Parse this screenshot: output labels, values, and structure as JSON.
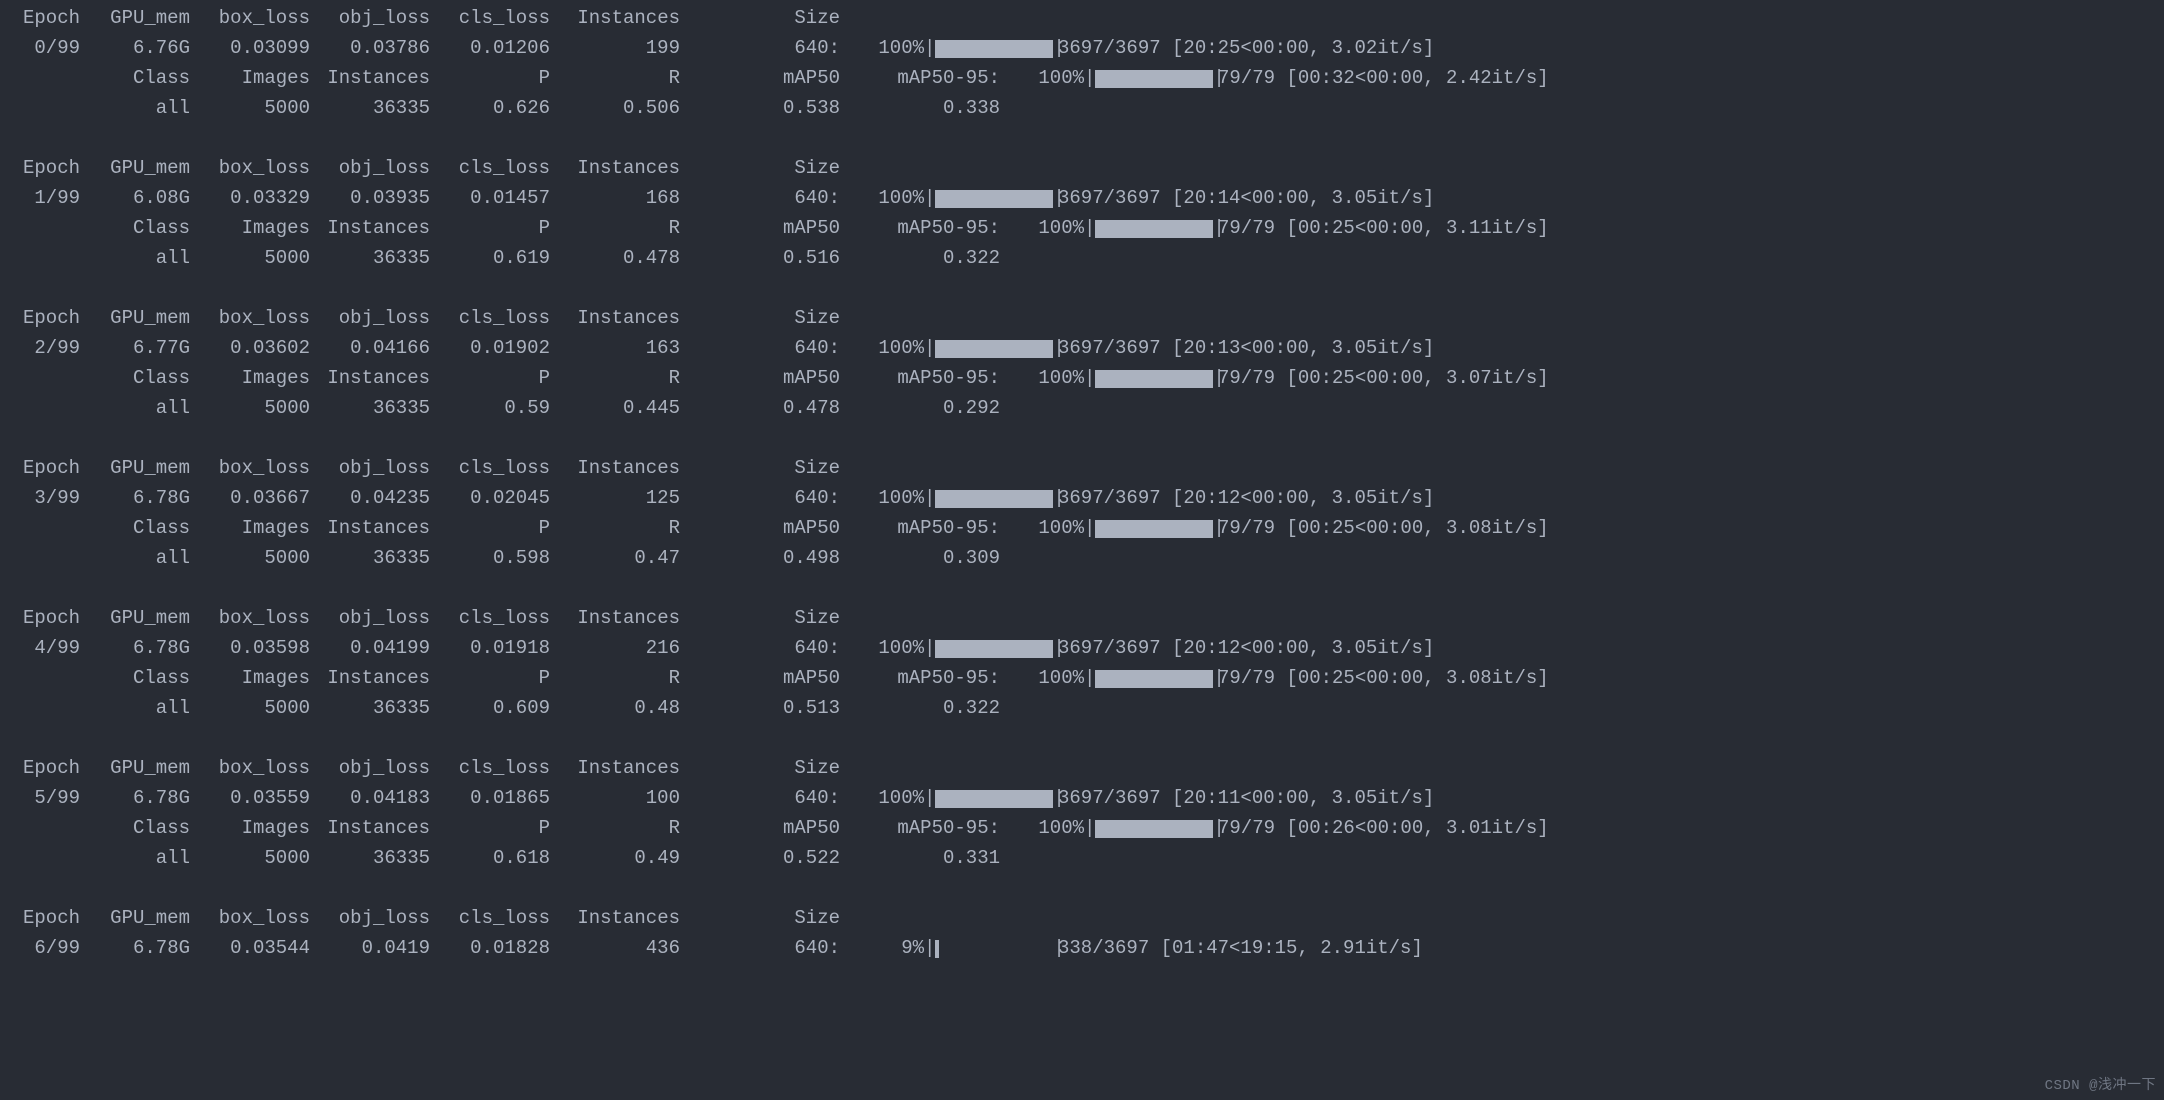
{
  "train_headers": {
    "epoch": "Epoch",
    "gpu_mem": "GPU_mem",
    "box_loss": "box_loss",
    "obj_loss": "obj_loss",
    "cls_loss": "cls_loss",
    "instances": "Instances",
    "size": "Size"
  },
  "val_headers": {
    "class": "Class",
    "images": "Images",
    "instances": "Instances",
    "p": "P",
    "r": "R",
    "map50": "mAP50",
    "map50_95_label": "mAP50-95:"
  },
  "epochs": [
    {
      "epoch": "0/99",
      "gpu_mem": "6.76G",
      "box_loss": "0.03099",
      "obj_loss": "0.03786",
      "cls_loss": "0.01206",
      "instances": "199",
      "size": "640:",
      "train_pct": "100%",
      "train_bar": "full",
      "train_stats": "3697/3697 [20:25<00:00,  3.02it/s]",
      "val_class": "all",
      "val_images": "5000",
      "val_instances": "36335",
      "val_p": "0.626",
      "val_r": "0.506",
      "val_map50": "0.538",
      "val_pct": "100%",
      "val_bar": "full",
      "val_stats": "79/79 [00:32<00:00,  2.42it/s]",
      "val_map50_95": "0.338"
    },
    {
      "epoch": "1/99",
      "gpu_mem": "6.08G",
      "box_loss": "0.03329",
      "obj_loss": "0.03935",
      "cls_loss": "0.01457",
      "instances": "168",
      "size": "640:",
      "train_pct": "100%",
      "train_bar": "full",
      "train_stats": "3697/3697 [20:14<00:00,  3.05it/s]",
      "val_class": "all",
      "val_images": "5000",
      "val_instances": "36335",
      "val_p": "0.619",
      "val_r": "0.478",
      "val_map50": "0.516",
      "val_pct": "100%",
      "val_bar": "full",
      "val_stats": "79/79 [00:25<00:00,  3.11it/s]",
      "val_map50_95": "0.322"
    },
    {
      "epoch": "2/99",
      "gpu_mem": "6.77G",
      "box_loss": "0.03602",
      "obj_loss": "0.04166",
      "cls_loss": "0.01902",
      "instances": "163",
      "size": "640:",
      "train_pct": "100%",
      "train_bar": "full",
      "train_stats": "3697/3697 [20:13<00:00,  3.05it/s]",
      "val_class": "all",
      "val_images": "5000",
      "val_instances": "36335",
      "val_p": "0.59",
      "val_r": "0.445",
      "val_map50": "0.478",
      "val_pct": "100%",
      "val_bar": "full",
      "val_stats": "79/79 [00:25<00:00,  3.07it/s]",
      "val_map50_95": "0.292"
    },
    {
      "epoch": "3/99",
      "gpu_mem": "6.78G",
      "box_loss": "0.03667",
      "obj_loss": "0.04235",
      "cls_loss": "0.02045",
      "instances": "125",
      "size": "640:",
      "train_pct": "100%",
      "train_bar": "full",
      "train_stats": "3697/3697 [20:12<00:00,  3.05it/s]",
      "val_class": "all",
      "val_images": "5000",
      "val_instances": "36335",
      "val_p": "0.598",
      "val_r": "0.47",
      "val_map50": "0.498",
      "val_pct": "100%",
      "val_bar": "full",
      "val_stats": "79/79 [00:25<00:00,  3.08it/s]",
      "val_map50_95": "0.309"
    },
    {
      "epoch": "4/99",
      "gpu_mem": "6.78G",
      "box_loss": "0.03598",
      "obj_loss": "0.04199",
      "cls_loss": "0.01918",
      "instances": "216",
      "size": "640:",
      "train_pct": "100%",
      "train_bar": "full",
      "train_stats": "3697/3697 [20:12<00:00,  3.05it/s]",
      "val_class": "all",
      "val_images": "5000",
      "val_instances": "36335",
      "val_p": "0.609",
      "val_r": "0.48",
      "val_map50": "0.513",
      "val_pct": "100%",
      "val_bar": "full",
      "val_stats": "79/79 [00:25<00:00,  3.08it/s]",
      "val_map50_95": "0.322"
    },
    {
      "epoch": "5/99",
      "gpu_mem": "6.78G",
      "box_loss": "0.03559",
      "obj_loss": "0.04183",
      "cls_loss": "0.01865",
      "instances": "100",
      "size": "640:",
      "train_pct": "100%",
      "train_bar": "full",
      "train_stats": "3697/3697 [20:11<00:00,  3.05it/s]",
      "val_class": "all",
      "val_images": "5000",
      "val_instances": "36335",
      "val_p": "0.618",
      "val_r": "0.49",
      "val_map50": "0.522",
      "val_pct": "100%",
      "val_bar": "full",
      "val_stats": "79/79 [00:26<00:00,  3.01it/s]",
      "val_map50_95": "0.331"
    },
    {
      "epoch": "6/99",
      "gpu_mem": "6.78G",
      "box_loss": "0.03544",
      "obj_loss": "0.0419",
      "cls_loss": "0.01828",
      "instances": "436",
      "size": "640:",
      "train_pct": "9%",
      "train_bar": "tiny",
      "train_stats": "338/3697 [01:47<19:15,  2.91it/s]",
      "in_progress": true
    }
  ],
  "watermark": "CSDN @浅冲一下"
}
